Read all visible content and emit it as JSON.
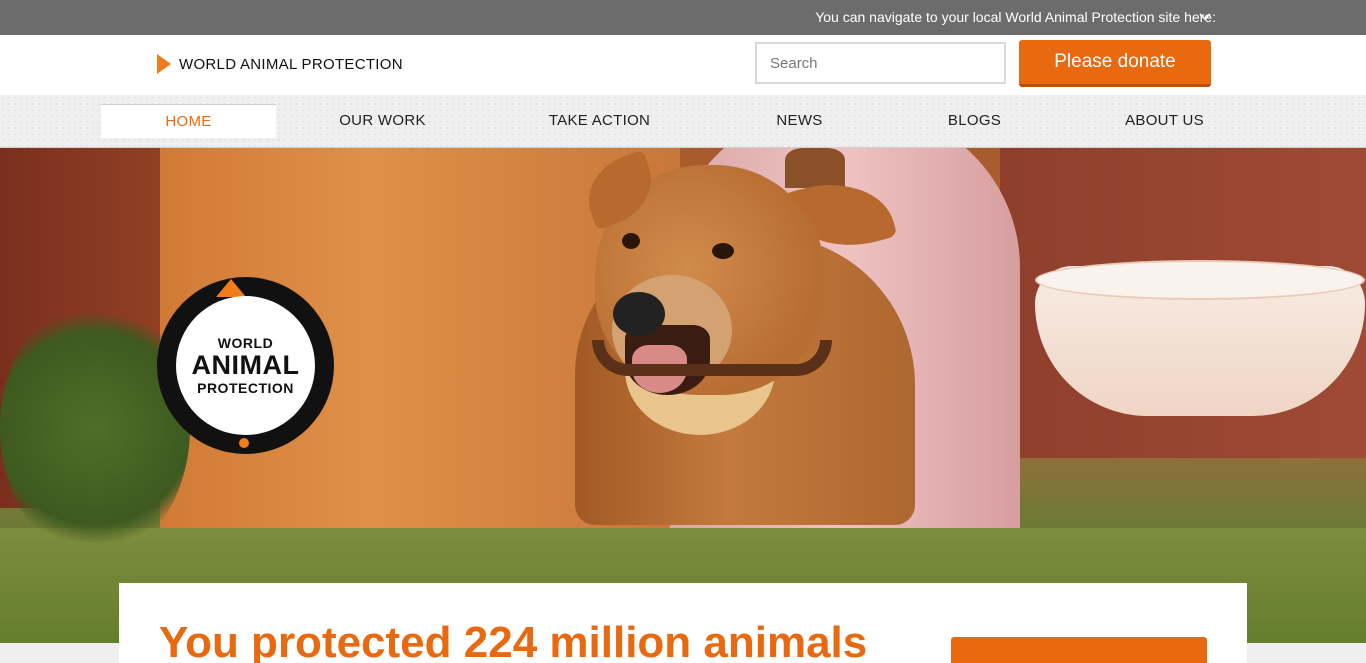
{
  "topbar": {
    "locale_text": "You can navigate to your local World Animal Protection site here:",
    "chevron_icon": "chevron-down-icon"
  },
  "header": {
    "logo_text": "WORLD ANIMAL PROTECTION",
    "search_placeholder": "Search",
    "donate_label": "Please donate"
  },
  "nav": {
    "items": [
      {
        "label": "HOME",
        "active": true
      },
      {
        "label": "OUR WORK",
        "active": false
      },
      {
        "label": "TAKE ACTION",
        "active": false
      },
      {
        "label": "NEWS",
        "active": false
      },
      {
        "label": "BLOGS",
        "active": false
      },
      {
        "label": "ABOUT US",
        "active": false
      }
    ]
  },
  "badge": {
    "line1": "WORLD",
    "line2": "ANIMAL",
    "line3": "PROTECTION"
  },
  "hero_card": {
    "headline": "You protected 224 million animals"
  },
  "colors": {
    "brand_orange": "#e8690f",
    "topbar_gray": "#6d6c6c"
  }
}
